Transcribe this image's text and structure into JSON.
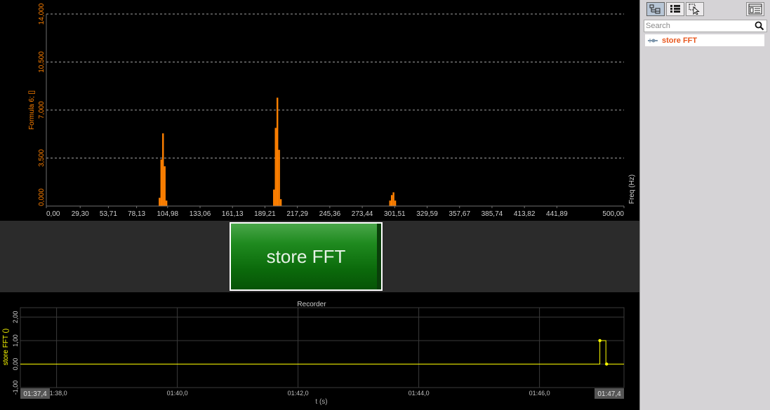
{
  "fft_chart": {
    "y_axis_label": "Formula 6; []",
    "x_axis_label": "Freq (Hz)",
    "y_ticks": [
      "0,000",
      "3,500",
      "7,000",
      "10,500",
      "14,000"
    ],
    "x_ticks": [
      "0,00",
      "29,30",
      "53,71",
      "78,13",
      "104,98",
      "133,06",
      "161,13",
      "189,21",
      "217,29",
      "245,36",
      "273,44",
      "301,51",
      "329,59",
      "357,67",
      "385,74",
      "413,82",
      "441,89",
      "500,00"
    ],
    "colors": {
      "bars": "#ff8000",
      "axis_text": "#d0d0d0",
      "y_label": "#ff8000",
      "grid": "#a0a0a0"
    }
  },
  "button": {
    "label": "store FFT"
  },
  "recorder": {
    "title": "Recorder",
    "y_axis_label": "store FFT ()",
    "x_axis_label": "t (s)",
    "y_ticks": [
      "-1,00",
      "0,00",
      "1,00",
      "2,00"
    ],
    "x_ticks": [
      "01:38,0",
      "01:40,0",
      "01:42,0",
      "01:44,0",
      "01:46,0"
    ],
    "start_time": "01:37,4",
    "end_time": "01:47,4",
    "colors": {
      "line": "#ffff00",
      "grid": "#3a3a3a"
    }
  },
  "sidebar": {
    "search_placeholder": "Search",
    "tree_items": [
      {
        "label": "store FFT"
      }
    ],
    "toolbar_icons": [
      "channel-tree-icon",
      "list-view-icon",
      "select-pointer-icon",
      "properties-panel-icon"
    ]
  },
  "chart_data": [
    {
      "type": "bar",
      "ylabel": "Formula 6; []",
      "xlabel": "Freq (Hz)",
      "xlim": [
        0,
        500
      ],
      "ylim": [
        0,
        14000
      ],
      "grid": true,
      "series": [
        {
          "x": [
            98,
            99.5,
            101,
            102.5,
            104
          ],
          "values": [
            600,
            3400,
            5300,
            2900,
            400
          ]
        },
        {
          "x": [
            197,
            198.5,
            200,
            201.5,
            203
          ],
          "values": [
            1200,
            5700,
            7900,
            4100,
            500
          ]
        },
        {
          "x": [
            297.5,
            299,
            300.5,
            302
          ],
          "values": [
            400,
            800,
            1000,
            400
          ]
        }
      ]
    },
    {
      "type": "line",
      "title": "Recorder",
      "ylabel": "store FFT ()",
      "xlabel": "t (s)",
      "ylim": [
        -1,
        2
      ],
      "grid": true,
      "series": [
        {
          "x": [
            "01:37,4",
            "01:47,0",
            "01:47,0",
            "01:47,1",
            "01:47,1",
            "01:47,4"
          ],
          "values": [
            0,
            0,
            1,
            1,
            0,
            0
          ]
        }
      ]
    }
  ]
}
